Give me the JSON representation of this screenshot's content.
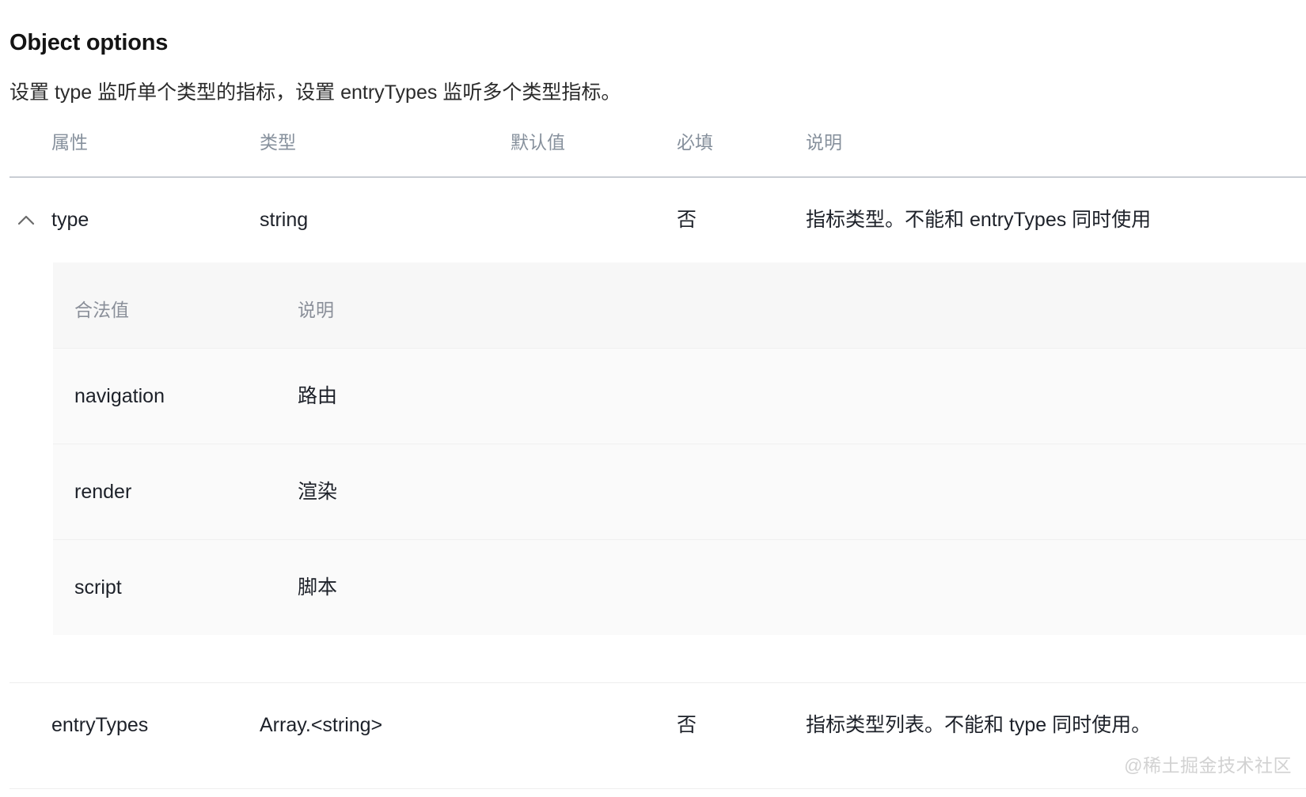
{
  "section": {
    "title": "Object options",
    "description": "设置 type 监听单个类型的指标，设置 entryTypes 监听多个类型指标。"
  },
  "table": {
    "columns": {
      "attribute": "属性",
      "type": "类型",
      "default": "默认值",
      "required": "必填",
      "description": "说明"
    },
    "rows": [
      {
        "attribute": "type",
        "type": "string",
        "default": "",
        "required": "否",
        "description": "指标类型。不能和 entryTypes 同时使用",
        "expanded": true,
        "toggle_icon": "chevron-up-icon"
      },
      {
        "attribute": "entryTypes",
        "type": "Array.<string>",
        "default": "",
        "required": "否",
        "description": "指标类型列表。不能和 type 同时使用。",
        "expanded": false,
        "toggle_icon": ""
      }
    ]
  },
  "subtable": {
    "columns": {
      "value": "合法值",
      "description": "说明"
    },
    "rows": [
      {
        "value": "navigation",
        "description": "路由"
      },
      {
        "value": "render",
        "description": "渲染"
      },
      {
        "value": "script",
        "description": "脚本"
      }
    ]
  },
  "watermark": {
    "text": "@稀土掘金技术社区"
  },
  "colors": {
    "text": "#1d2129",
    "muted": "#86909c",
    "panel_header_bg": "#f7f7f7",
    "panel_row_bg": "#fafafa",
    "border": "#c9cdd4",
    "watermark": "#d2d2d2"
  }
}
